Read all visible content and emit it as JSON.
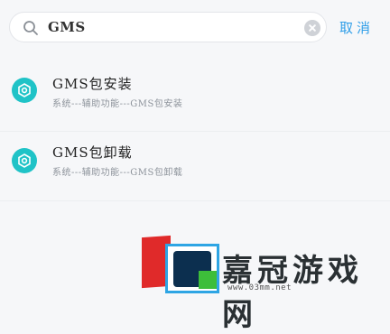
{
  "search": {
    "query": "GMS",
    "cancel_label": "取消"
  },
  "results": [
    {
      "title": "GMS包安装",
      "subtitle": "系统---辅助功能---GMS包安装",
      "icon": "gear-icon"
    },
    {
      "title": "GMS包卸载",
      "subtitle": "系统---辅助功能---GMS包卸载",
      "icon": "gear-icon"
    }
  ],
  "watermark": {
    "brand": "嘉冠游戏网",
    "url": "www.03mm.net"
  },
  "colors": {
    "accent": "#2f9ee8",
    "icon_bg": "#1fc3c7",
    "background": "#f6f7f9"
  }
}
